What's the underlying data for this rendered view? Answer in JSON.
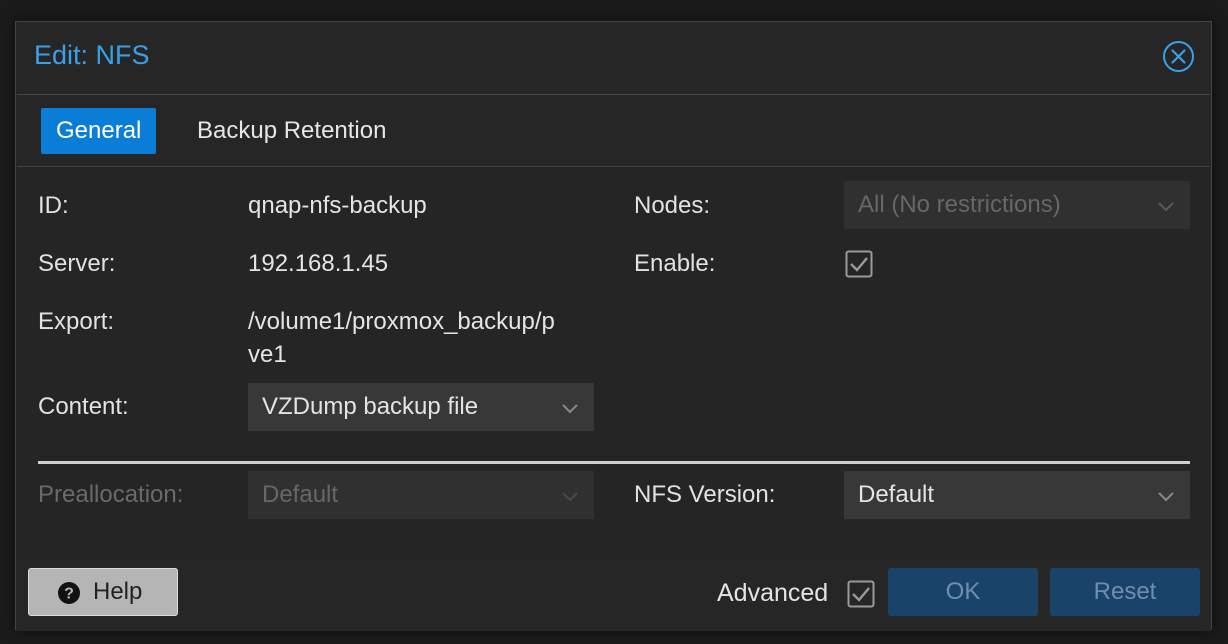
{
  "dialog": {
    "title": "Edit: NFS"
  },
  "tabs": [
    {
      "label": "General",
      "active": true
    },
    {
      "label": "Backup Retention",
      "active": false
    }
  ],
  "general": {
    "id_label": "ID:",
    "id_value": "qnap-nfs-backup",
    "server_label": "Server:",
    "server_value": "192.168.1.45",
    "export_label": "Export:",
    "export_value_line1": "/volume1/proxmox_backup/p",
    "export_value_line2": "ve1",
    "content_label": "Content:",
    "content_value": "VZDump backup file",
    "nodes_label": "Nodes:",
    "nodes_value": "All (No restrictions)",
    "enable_label": "Enable:",
    "enable_checked": true,
    "preallocation_label": "Preallocation:",
    "preallocation_value": "Default",
    "nfs_version_label": "NFS Version:",
    "nfs_version_value": "Default"
  },
  "footer": {
    "help_label": "Help",
    "advanced_label": "Advanced",
    "advanced_checked": true,
    "ok_label": "OK",
    "reset_label": "Reset"
  },
  "colors": {
    "accent": "#3aa0e8",
    "tab_active": "#0a7dd6",
    "button_disabled": "#1a4369"
  },
  "icons": {
    "close": "close-circle-icon",
    "chevron": "chevron-down-icon",
    "check": "checkbox-checked-icon",
    "help": "question-circle-icon"
  }
}
